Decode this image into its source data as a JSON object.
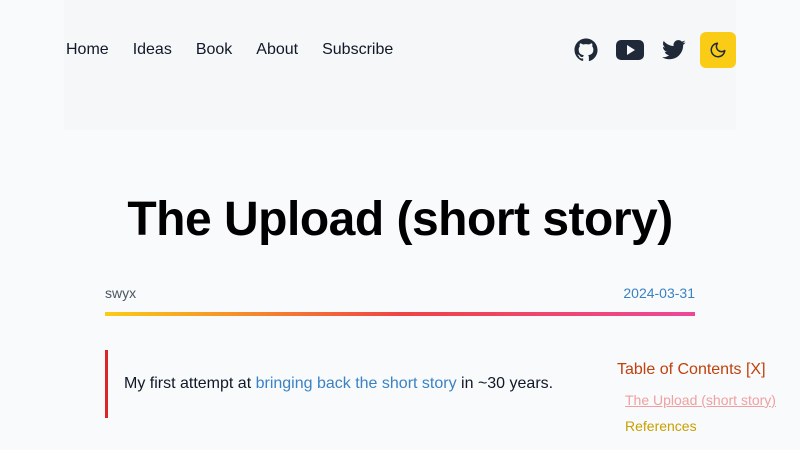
{
  "nav": {
    "links": [
      "Home",
      "Ideas",
      "Book",
      "About",
      "Subscribe"
    ],
    "icons": [
      "github-icon",
      "youtube-icon",
      "twitter-icon",
      "moon-icon"
    ]
  },
  "article": {
    "title": "The Upload (short story)",
    "author": "swyx",
    "date": "2024-03-31",
    "intro_prefix": "My first attempt at ",
    "intro_link": "bringing back the short story",
    "intro_suffix": " in ~30 years."
  },
  "toc": {
    "heading": "Table of Contents [X]",
    "items": [
      "The Upload (short story)",
      "References"
    ]
  },
  "colors": {
    "theme_toggle": "#facc15",
    "link": "#3b82c4",
    "quote_border": "#dc2626",
    "toc_heading": "#c2410c"
  }
}
